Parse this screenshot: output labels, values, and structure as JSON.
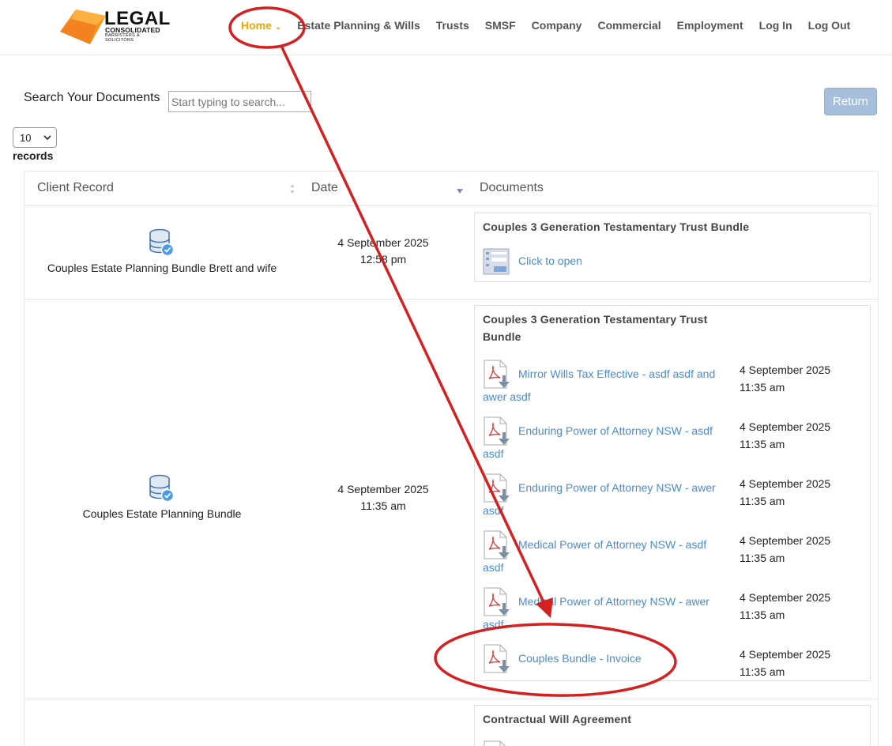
{
  "header": {
    "logo": {
      "word": "LEGAL",
      "sub1": "CONSOLIDATED",
      "sub2": "BARRISTERS & SOLICITORS"
    },
    "nav": [
      {
        "label": "Home",
        "active": true
      },
      {
        "label": "Estate Planning & Wills"
      },
      {
        "label": "Trusts"
      },
      {
        "label": "SMSF"
      },
      {
        "label": "Company"
      },
      {
        "label": "Commercial"
      },
      {
        "label": "Employment"
      },
      {
        "label": "Log In"
      },
      {
        "label": "Log Out"
      }
    ],
    "home_chevron": "chevron-down-icon"
  },
  "search": {
    "label": "Search Your Documents",
    "placeholder": "Start typing to search..."
  },
  "return_button": "Return",
  "records": {
    "value": "10",
    "label": "records"
  },
  "table": {
    "columns": [
      "Client Record",
      "Date",
      "Documents"
    ],
    "rows": [
      {
        "client": "Couples Estate Planning Bundle Brett and wife",
        "date": "4 September 2025",
        "time": "12:58 pm",
        "bundle_title": "Couples 3 Generation Testamentary Trust Bundle",
        "open_label": "Click to open"
      },
      {
        "client": "Couples Estate Planning Bundle",
        "date": "4 September 2025",
        "time": "11:35 am",
        "bundle_title_line1": "Couples 3 Generation Testamentary Trust",
        "bundle_title_line2": "Bundle",
        "documents": [
          {
            "name": "Mirror Wills Tax Effective - asdf asdf and awer asdf",
            "date": "4 September 2025",
            "time": "11:35 am"
          },
          {
            "name": "Enduring Power of Attorney NSW - asdf asdf",
            "date": "4 September 2025",
            "time": "11:35 am"
          },
          {
            "name": "Enduring Power of Attorney NSW - awer asdf",
            "date": "4 September 2025",
            "time": "11:35 am"
          },
          {
            "name": "Medical Power of Attorney NSW - asdf asdf",
            "date": "4 September 2025",
            "time": "11:35 am"
          },
          {
            "name": "Medical Power of Attorney NSW - awer asdf",
            "date": "4 September 2025",
            "time": "11:35 am"
          },
          {
            "name": "Couples Bundle - Invoice",
            "date": "4 September 2025",
            "time": "11:35 am"
          }
        ]
      },
      {
        "bundle_title": "Contractual Will Agreement"
      }
    ]
  },
  "annotation": {
    "color": "#d42020"
  }
}
